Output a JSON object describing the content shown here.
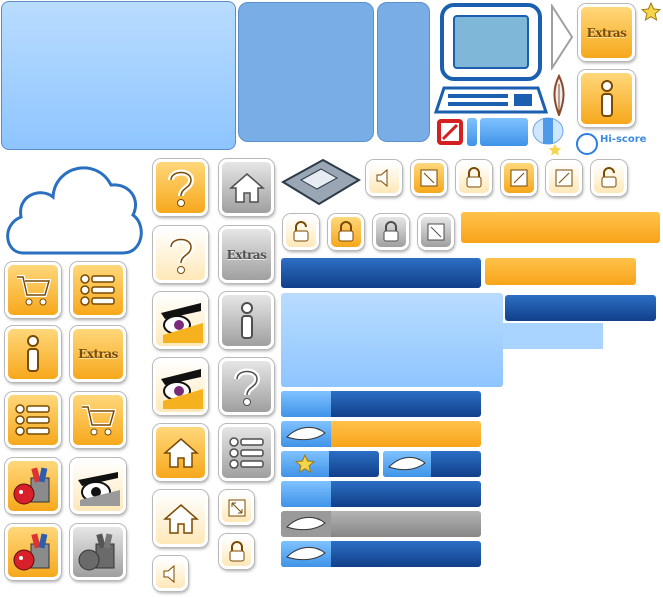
{
  "labels": {
    "extras": "Extras",
    "hiscore": "Hi-score",
    "help_mark": "?",
    "info_mark": "i"
  },
  "colors": {
    "yellow_button": "#f6a81c",
    "grey_button": "#9f9f9f",
    "panel_light_blue": "#9fd0ff",
    "bar_dark_blue": "#1a4f9f",
    "bar_orange": "#f8a41a",
    "bar_grey": "#8a8a8a"
  },
  "icons": [
    "computer-icon",
    "cloud-icon",
    "shop-cart-icon",
    "list-icon",
    "info-icon",
    "extras-label",
    "help-icon",
    "home-icon",
    "angry-eye-icon",
    "trash-bird-icon",
    "floppy-disk-icon",
    "sound-icon",
    "lock-icon",
    "unlock-icon",
    "resize-icon",
    "feather-icon",
    "star-icon",
    "no-entry-icon",
    "arrow-icon"
  ]
}
